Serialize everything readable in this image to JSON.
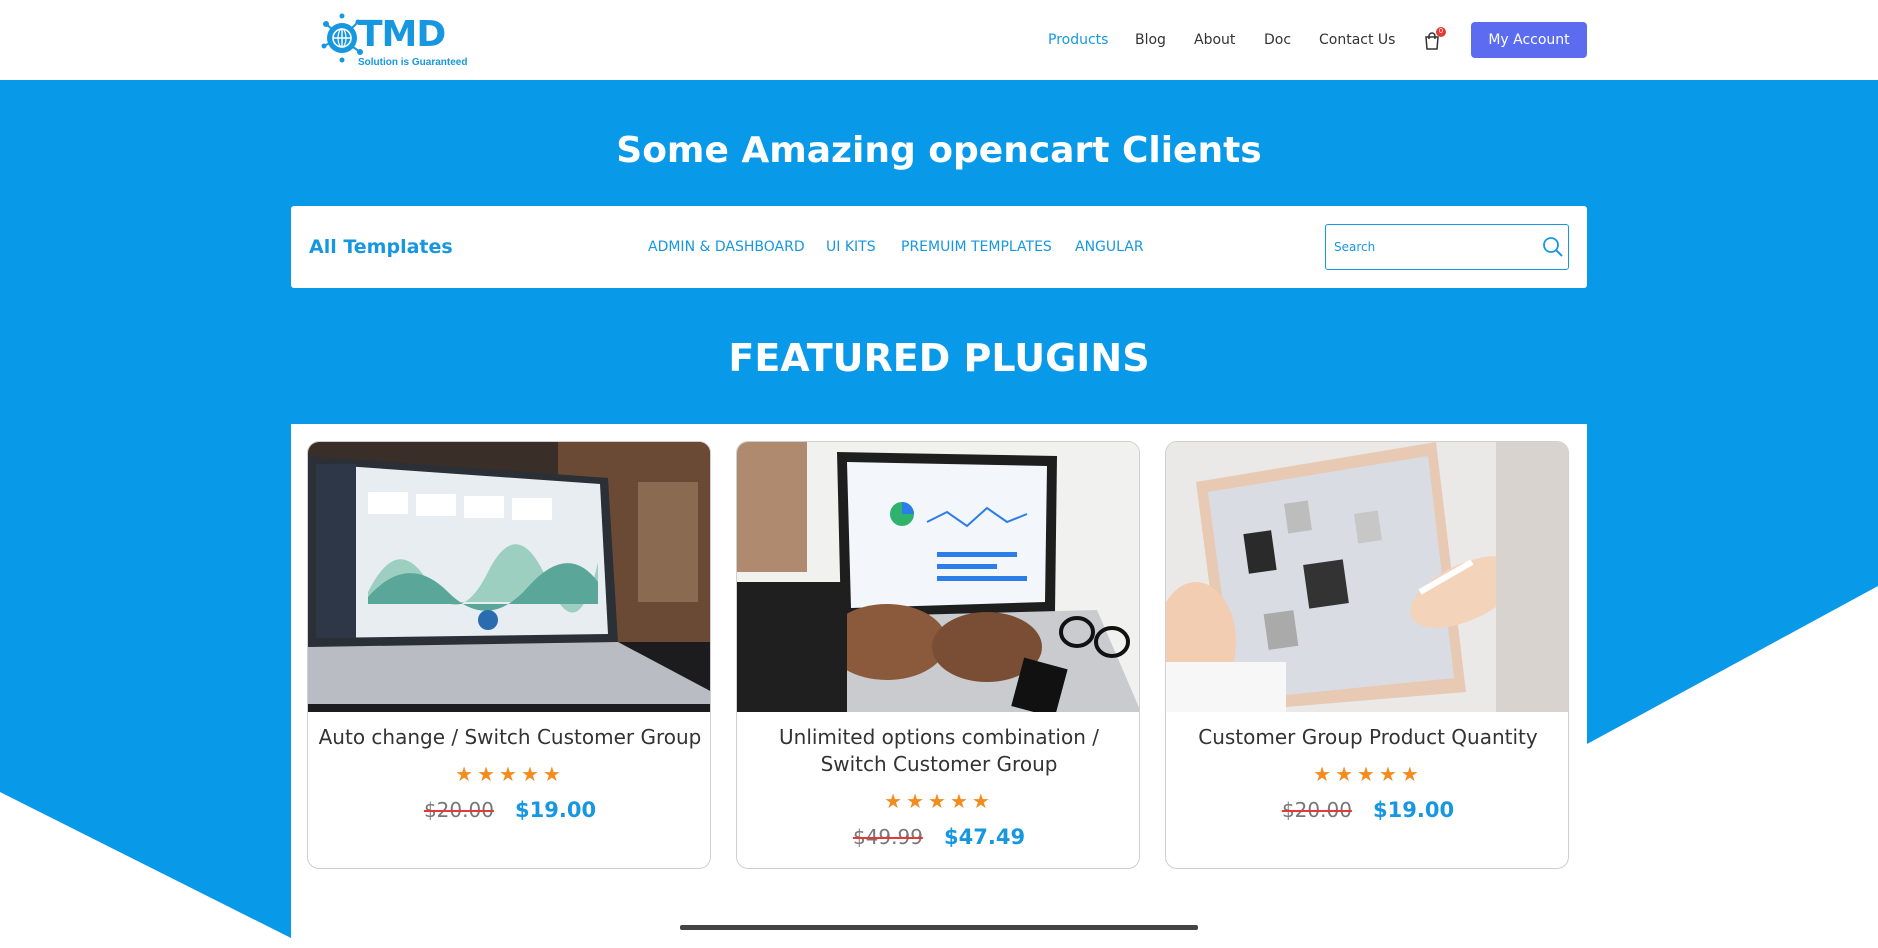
{
  "header": {
    "logo_text": "TMD",
    "logo_tagline": "Solution is Guaranteed",
    "nav": [
      {
        "label": "Products",
        "active": true
      },
      {
        "label": "Blog"
      },
      {
        "label": "About"
      },
      {
        "label": "Doc"
      },
      {
        "label": "Contact Us"
      }
    ],
    "cart_count": "0",
    "account_label": "My Account"
  },
  "hero": {
    "title": "Some Amazing opencart Clients"
  },
  "filter": {
    "all_label": "All Templates",
    "categories": [
      "ADMIN & DASHBOARD",
      "UI KITS",
      "PREMUIM TEMPLATES",
      "ANGULAR"
    ],
    "search_placeholder": "Search"
  },
  "featured": {
    "title": "FEATURED PLUGINS",
    "products": [
      {
        "title": "Auto change / Switch Customer Group",
        "rating": 5,
        "stars": "★★★★★",
        "old_price": "$20.00",
        "price": "$19.00"
      },
      {
        "title": "Unlimited options combination / Switch Customer Group",
        "rating": 5,
        "stars": "★★★★★",
        "old_price": "$49.99",
        "price": "$47.49"
      },
      {
        "title": "Customer Group Product Quantity",
        "rating": 5,
        "stars": "★★★★★",
        "old_price": "$20.00",
        "price": "$19.00"
      }
    ]
  },
  "colors": {
    "brand_blue": "#0899e8",
    "link_blue": "#1797e0",
    "account_button": "#5b6cf0",
    "star": "#f28c1e",
    "strike": "#e53935"
  },
  "icons": [
    "globe-logo-icon",
    "cart-icon",
    "search-icon",
    "star-icon"
  ]
}
